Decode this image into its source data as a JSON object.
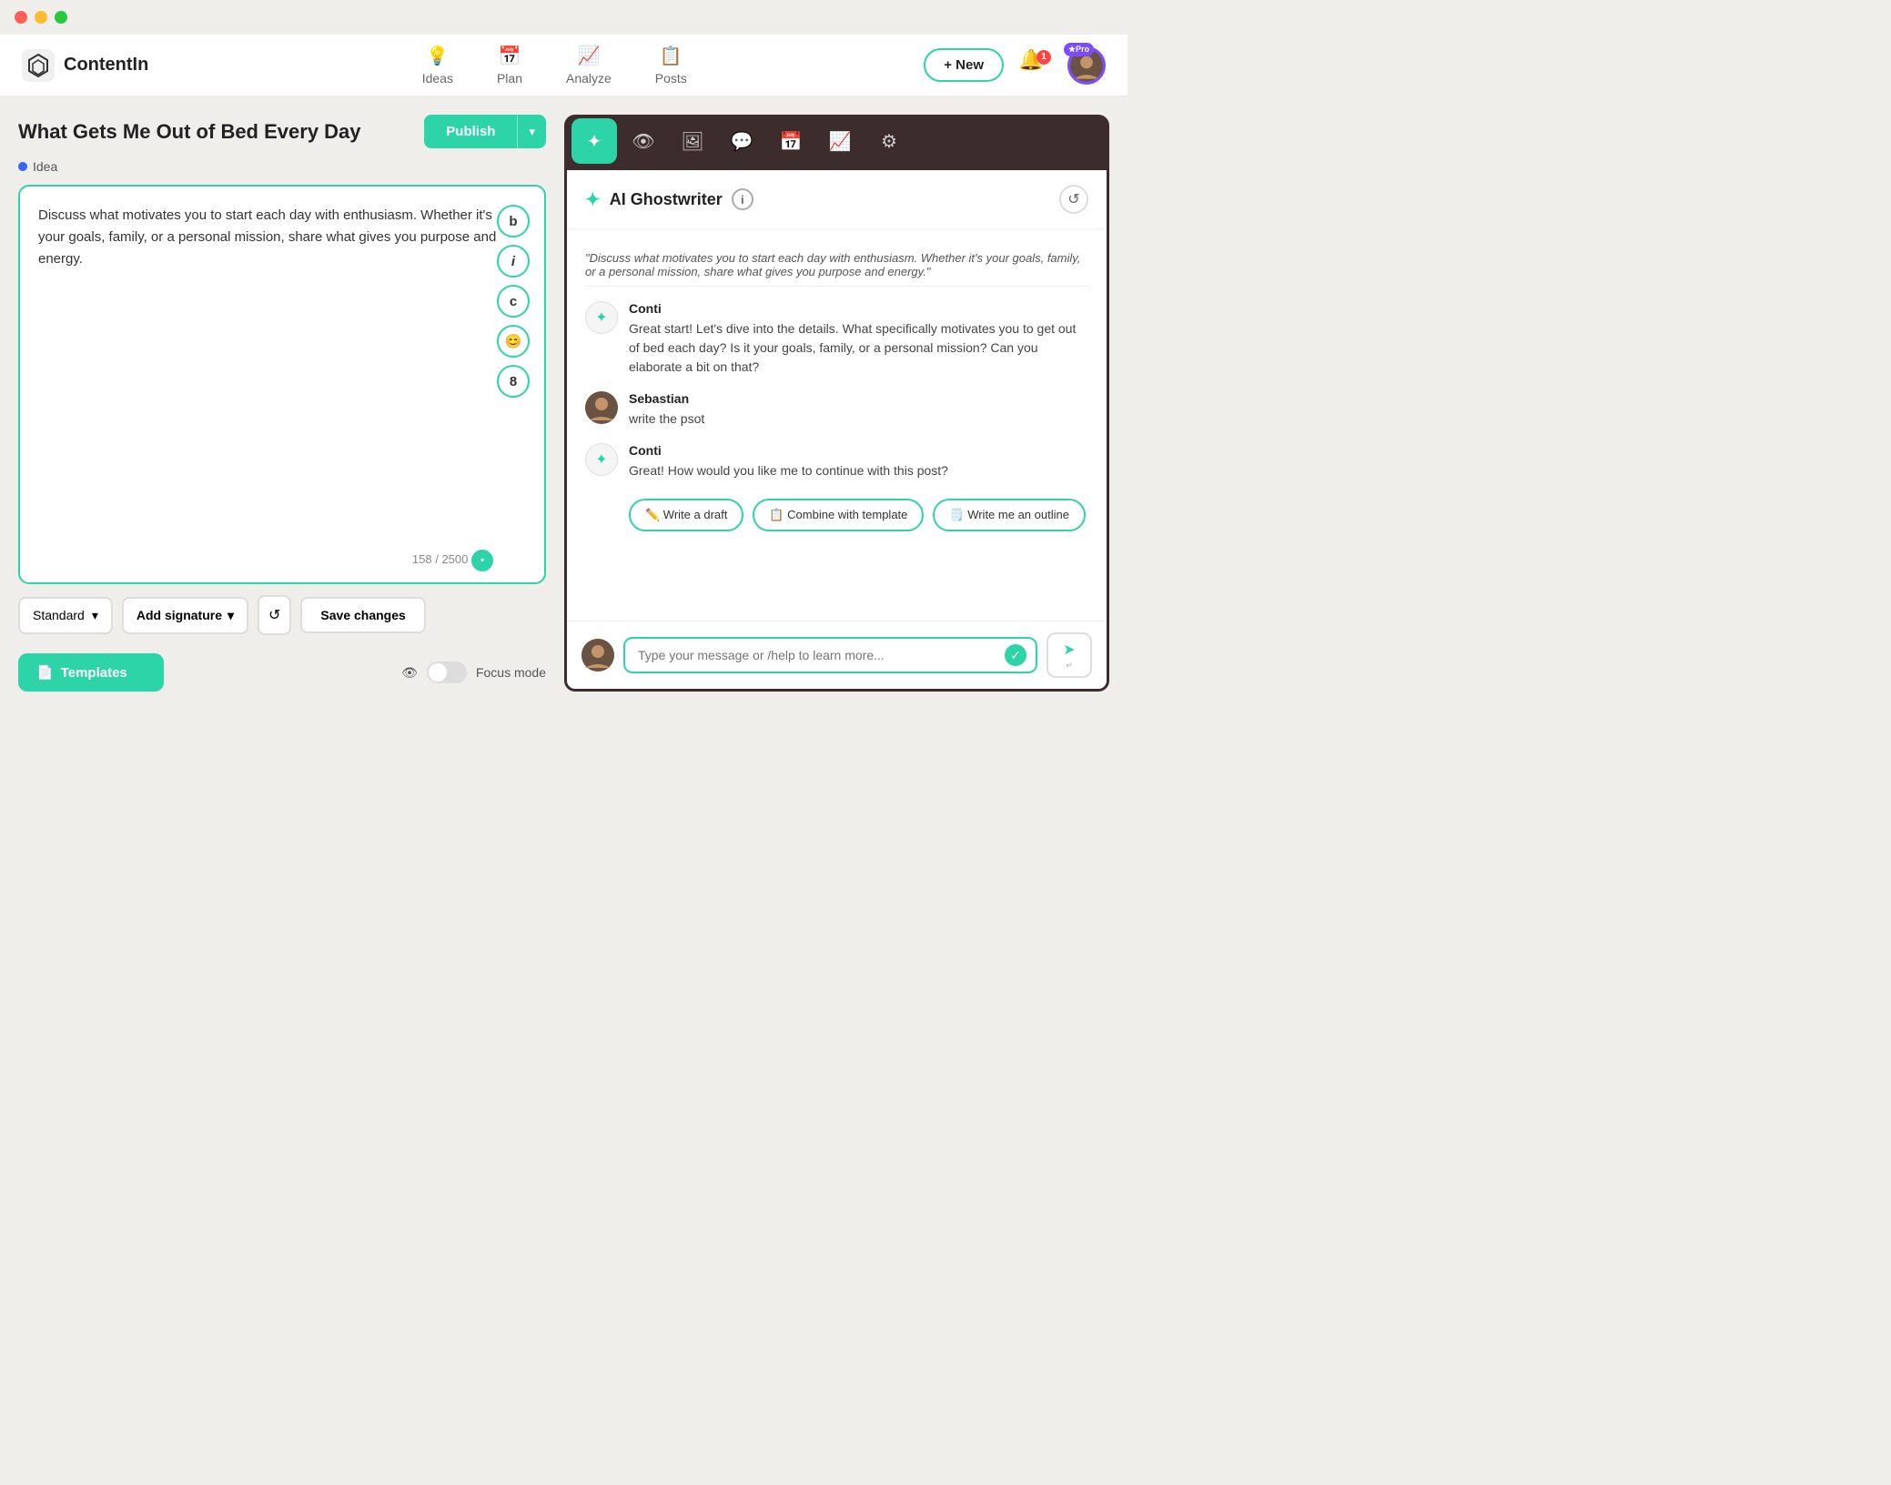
{
  "titlebar": {
    "dots": [
      "red-dot",
      "yellow-dot",
      "green-dot"
    ]
  },
  "topnav": {
    "logo_text": "ContentIn",
    "nav_items": [
      {
        "id": "ideas",
        "label": "Ideas",
        "icon": "💡"
      },
      {
        "id": "plan",
        "label": "Plan",
        "icon": "📅"
      },
      {
        "id": "analyze",
        "label": "Analyze",
        "icon": "📈"
      },
      {
        "id": "posts",
        "label": "Posts",
        "icon": "📋"
      }
    ],
    "new_btn_label": "+ New",
    "notif_count": "1",
    "pro_badge": "★Pro"
  },
  "post": {
    "title": "What Gets Me Out of Bed Every Day",
    "publish_label": "Publish",
    "idea_label": "Idea",
    "content": "Discuss what motivates you to start each day with enthusiasm. Whether it's your goals, family, or a personal mission, share what gives you purpose and energy.",
    "char_count": "158 / 2500",
    "tools": [
      "b",
      "i",
      "c",
      "😊",
      "8"
    ]
  },
  "toolbar": {
    "standard_label": "Standard",
    "add_signature_label": "Add signature",
    "save_label": "Save changes"
  },
  "templates": {
    "label": "Templates"
  },
  "focus_mode": {
    "label": "Focus mode"
  },
  "ai": {
    "title": "AI Ghostwriter",
    "tabs": [
      {
        "id": "sparkle",
        "icon": "✦",
        "active": true
      },
      {
        "id": "eye",
        "icon": "👁"
      },
      {
        "id": "image",
        "icon": "🖼"
      },
      {
        "id": "chat",
        "icon": "💬"
      },
      {
        "id": "calendar",
        "icon": "📅"
      },
      {
        "id": "analytics",
        "icon": "📈"
      },
      {
        "id": "gear",
        "icon": "⚙"
      }
    ],
    "quoted_text": "\"Discuss what motivates you to start each day with enthusiasm. Whether it's your goals, family, or a personal mission, share what gives you purpose and energy.\"",
    "messages": [
      {
        "id": "ai-1",
        "sender": "Conti",
        "type": "ai",
        "text": "Great start! Let's dive into the details. What specifically motivates you to get out of bed each day? Is it your goals, family, or a personal mission? Can you elaborate a bit on that?"
      },
      {
        "id": "user-1",
        "sender": "Sebastian",
        "type": "user",
        "text": "write the psot"
      },
      {
        "id": "ai-2",
        "sender": "Conti",
        "type": "ai",
        "text": "Great! How would you like me to continue with this post?"
      }
    ],
    "action_buttons": [
      {
        "id": "write-draft",
        "label": "✏️ Write a draft"
      },
      {
        "id": "combine-template",
        "label": "📋 Combine with template"
      },
      {
        "id": "write-outline",
        "label": "🗒️ Write me an outline"
      }
    ],
    "input_placeholder": "Type your message or /help to learn more..."
  }
}
